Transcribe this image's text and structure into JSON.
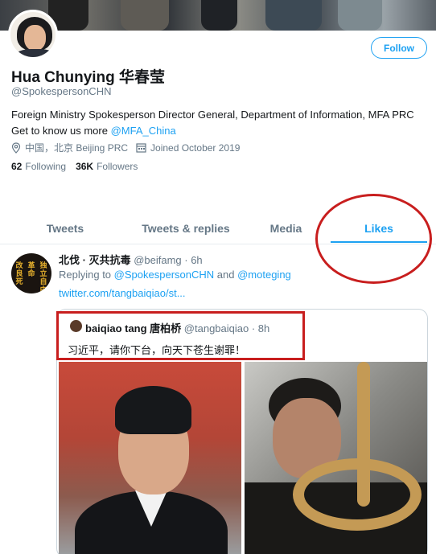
{
  "profile": {
    "name": "Hua Chunying 华春莹",
    "handle": "@SpokespersonCHN",
    "bio_text": "Foreign Ministry Spokesperson Director General, Department of Information, MFA PRC Get to know us more",
    "bio_link": "@MFA_China",
    "location": "中国，北京 Beijing PRC",
    "joined": "Joined October 2019",
    "following_count": "62",
    "following_label": "Following",
    "followers_count": "36K",
    "followers_label": "Followers",
    "follow_button": "Follow"
  },
  "tabs": [
    {
      "label": "Tweets"
    },
    {
      "label": "Tweets & replies"
    },
    {
      "label": "Media"
    },
    {
      "label": "Likes"
    }
  ],
  "tweet": {
    "author_name": "北伐 · 灭共抗毒",
    "author_handle": "@beifamg",
    "time": "· 6h",
    "reply_prefix": "Replying to",
    "reply_to_1": "@SpokespersonCHN",
    "reply_and": "and",
    "reply_to_2": "@moteging",
    "link": "twitter.com/tangbaiqiao/st...",
    "avatar_text": [
      "革命",
      "改良",
      "独立",
      "自由",
      "死"
    ],
    "quote": {
      "author_name": "baiqiao tang 唐柏桥",
      "author_handle": "@tangbaiqiao",
      "time": "· 8h",
      "text": "习近平，请你下台，向天下苍生谢罪！"
    }
  },
  "colors": {
    "accent": "#1da1f2",
    "annotation": "#c81e1e",
    "muted": "#657786"
  }
}
